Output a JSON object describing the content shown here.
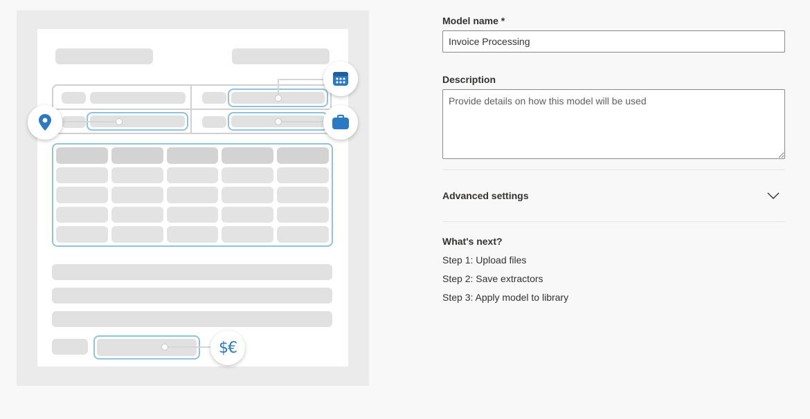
{
  "illustration": {
    "currency_symbol": "$€"
  },
  "form": {
    "model_name": {
      "label": "Model name *",
      "value": "Invoice Processing"
    },
    "description": {
      "label": "Description",
      "placeholder": "Provide details on how this model will be used"
    },
    "advanced_settings": {
      "label": "Advanced settings"
    },
    "whats_next": {
      "title": "What's next?",
      "steps": [
        "Step 1: Upload files",
        "Step 2: Save extractors",
        "Step 3: Apply model to library"
      ]
    }
  },
  "colors": {
    "icon_blue": "#2b79c2",
    "highlight_border": "#8ec2e2"
  }
}
